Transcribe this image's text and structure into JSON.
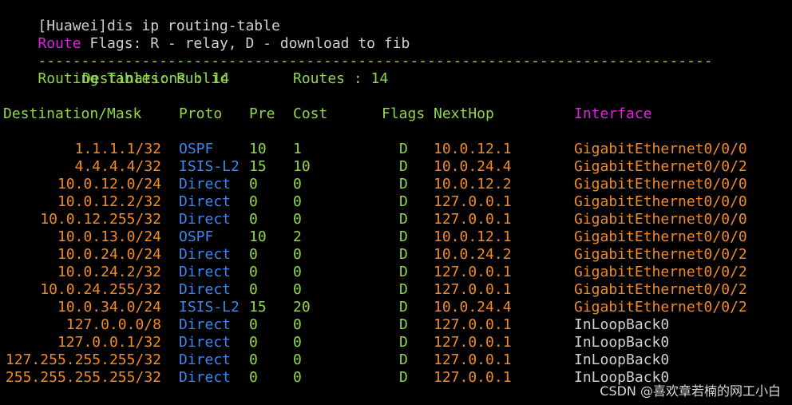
{
  "command_line": "[Huawei]dis ip routing-table",
  "flags_line": {
    "route_word": "Route",
    "rest": " Flags: R - relay, D - download to fib"
  },
  "separator": "------------------------------------------------------------------------------",
  "routing_tables": "Routing Tables: Public",
  "summary": {
    "destinations": "Destinations : 14",
    "routes": "Routes : 14"
  },
  "headers": {
    "destination": "Destination/Mask",
    "proto": "Proto",
    "pre": "Pre",
    "cost": "Cost",
    "flags": "Flags",
    "nexthop": "NextHop",
    "interface": "Interface"
  },
  "rows": [
    {
      "dest": "1.1.1.1/32",
      "proto": "OSPF",
      "pre": "10",
      "cost": "1",
      "flag": "D",
      "nexthop": "10.0.12.1",
      "iface": "GigabitEthernet0/0/0"
    },
    {
      "dest": "4.4.4.4/32",
      "proto": "ISIS-L2",
      "pre": "15",
      "cost": "10",
      "flag": "D",
      "nexthop": "10.0.24.4",
      "iface": "GigabitEthernet0/0/2"
    },
    {
      "dest": "10.0.12.0/24",
      "proto": "Direct",
      "pre": "0",
      "cost": "0",
      "flag": "D",
      "nexthop": "10.0.12.2",
      "iface": "GigabitEthernet0/0/0"
    },
    {
      "dest": "10.0.12.2/32",
      "proto": "Direct",
      "pre": "0",
      "cost": "0",
      "flag": "D",
      "nexthop": "127.0.0.1",
      "iface": "GigabitEthernet0/0/0"
    },
    {
      "dest": "10.0.12.255/32",
      "proto": "Direct",
      "pre": "0",
      "cost": "0",
      "flag": "D",
      "nexthop": "127.0.0.1",
      "iface": "GigabitEthernet0/0/0"
    },
    {
      "dest": "10.0.13.0/24",
      "proto": "OSPF",
      "pre": "10",
      "cost": "2",
      "flag": "D",
      "nexthop": "10.0.12.1",
      "iface": "GigabitEthernet0/0/0"
    },
    {
      "dest": "10.0.24.0/24",
      "proto": "Direct",
      "pre": "0",
      "cost": "0",
      "flag": "D",
      "nexthop": "10.0.24.2",
      "iface": "GigabitEthernet0/0/2"
    },
    {
      "dest": "10.0.24.2/32",
      "proto": "Direct",
      "pre": "0",
      "cost": "0",
      "flag": "D",
      "nexthop": "127.0.0.1",
      "iface": "GigabitEthernet0/0/2"
    },
    {
      "dest": "10.0.24.255/32",
      "proto": "Direct",
      "pre": "0",
      "cost": "0",
      "flag": "D",
      "nexthop": "127.0.0.1",
      "iface": "GigabitEthernet0/0/2"
    },
    {
      "dest": "10.0.34.0/24",
      "proto": "ISIS-L2",
      "pre": "15",
      "cost": "20",
      "flag": "D",
      "nexthop": "10.0.24.4",
      "iface": "GigabitEthernet0/0/2"
    },
    {
      "dest": "127.0.0.0/8",
      "proto": "Direct",
      "pre": "0",
      "cost": "0",
      "flag": "D",
      "nexthop": "127.0.0.1",
      "iface": "InLoopBack0"
    },
    {
      "dest": "127.0.0.1/32",
      "proto": "Direct",
      "pre": "0",
      "cost": "0",
      "flag": "D",
      "nexthop": "127.0.0.1",
      "iface": "InLoopBack0"
    },
    {
      "dest": "127.255.255.255/32",
      "proto": "Direct",
      "pre": "0",
      "cost": "0",
      "flag": "D",
      "nexthop": "127.0.0.1",
      "iface": "InLoopBack0"
    },
    {
      "dest": "255.255.255.255/32",
      "proto": "Direct",
      "pre": "0",
      "cost": "0",
      "flag": "D",
      "nexthop": "127.0.0.1",
      "iface": "InLoopBack0"
    }
  ],
  "watermark": "CSDN @喜欢章若楠的网工小白",
  "colors": {
    "background": "#000000",
    "default_text": "#cfcfcf",
    "keyword_magenta": "#e020e0",
    "heading_green": "#36c436",
    "destination_orange": "#f08a24",
    "proto_blue": "#3b86f2",
    "interface_loopback_white": "#d0d0d0"
  }
}
